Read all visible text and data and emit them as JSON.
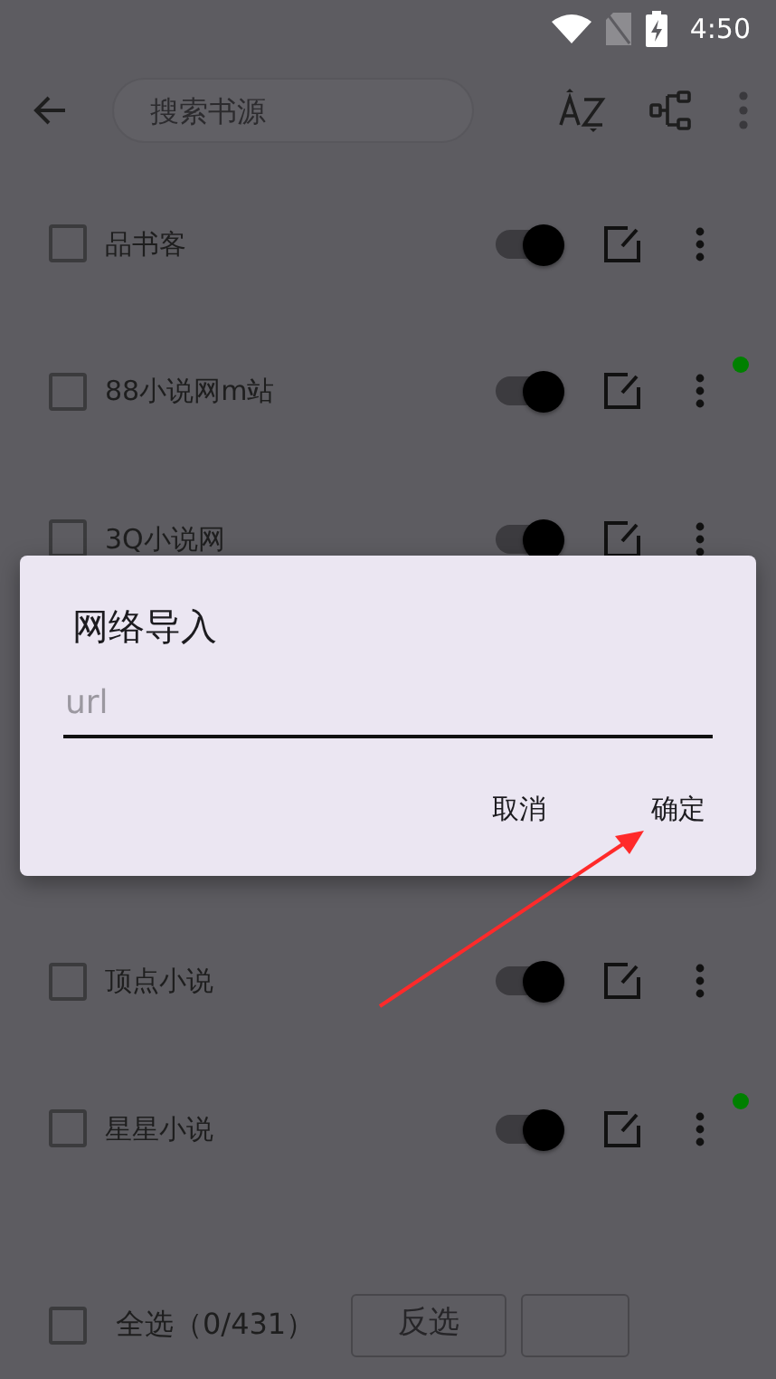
{
  "status_bar": {
    "time": "4:50"
  },
  "toolbar": {
    "search": {
      "placeholder": "搜索书源"
    }
  },
  "sources": [
    {
      "name": "品书客",
      "checked": false,
      "enabled": true,
      "dot": false
    },
    {
      "name": "88小说网m站",
      "checked": false,
      "enabled": true,
      "dot": true
    },
    {
      "name": "3Q小说网",
      "checked": false,
      "enabled": true,
      "dot": false
    },
    {
      "name": "顶点小说",
      "checked": false,
      "enabled": true,
      "dot": false
    },
    {
      "name": "星星小说",
      "checked": false,
      "enabled": true,
      "dot": true
    }
  ],
  "bottom_bar": {
    "select_all": {
      "label": "全选（0/431）",
      "checked": false
    },
    "buttons": [
      "反选"
    ]
  },
  "dialog": {
    "title": "网络导入",
    "field": {
      "placeholder": "url"
    },
    "buttons": [
      "取消",
      "确定"
    ]
  }
}
